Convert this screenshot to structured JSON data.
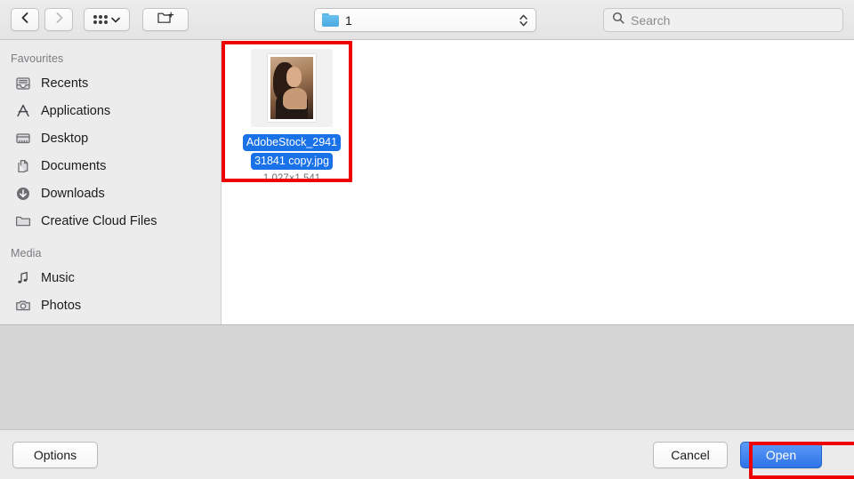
{
  "toolbar": {
    "back_icon": "chevron-left-icon",
    "forward_icon": "chevron-right-icon",
    "view_mode_icon": "grid-view-icon",
    "view_mode_chevron": "chevron-down-icon",
    "new_folder_icon": "new-folder-icon",
    "location": {
      "folder_icon": "blue-folder-icon",
      "label": "1",
      "stepper_icon": "up-down-chevron-icon"
    },
    "search": {
      "icon": "search-icon",
      "placeholder": "Search",
      "value": ""
    }
  },
  "sidebar": {
    "groups": [
      {
        "title": "Favourites",
        "items": [
          {
            "label": "Recents",
            "icon": "recents-tray-icon"
          },
          {
            "label": "Applications",
            "icon": "applications-icon"
          },
          {
            "label": "Desktop",
            "icon": "desktop-icon"
          },
          {
            "label": "Documents",
            "icon": "documents-icon"
          },
          {
            "label": "Downloads",
            "icon": "downloads-arrow-icon"
          },
          {
            "label": "Creative Cloud Files",
            "icon": "folder-icon"
          }
        ]
      },
      {
        "title": "Media",
        "items": [
          {
            "label": "Music",
            "icon": "music-note-icon"
          },
          {
            "label": "Photos",
            "icon": "camera-icon"
          }
        ]
      }
    ]
  },
  "content": {
    "file": {
      "name_line1": "AdobeStock_2941",
      "name_line2": "31841 copy.jpg",
      "dimensions": "1 027×1 541",
      "selected": true,
      "thumbnail_icon": "photo-thumbnail"
    }
  },
  "footer": {
    "options_label": "Options",
    "cancel_label": "Cancel",
    "open_label": "Open"
  },
  "annotations": {
    "file_box_color": "#ee0000",
    "open_box_color": "#ee0000"
  },
  "colors": {
    "selection_blue": "#1a72e8",
    "default_button_blue": "#2f73e8",
    "toolbar_gray": "#e8e8e8",
    "sidebar_gray": "#ececed",
    "preview_gray": "#d6d6d6"
  }
}
